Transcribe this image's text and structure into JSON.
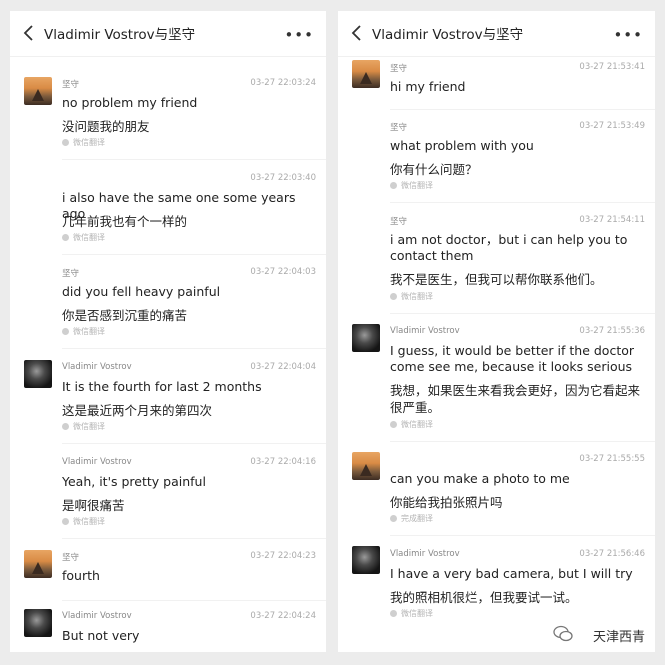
{
  "left": {
    "title": "Vladimir Vostrov与坚守",
    "messages": [
      {
        "sender": "坚守",
        "time": "03-27 22:03:24",
        "en": "no problem my friend",
        "zh": "没问题我的朋友",
        "tr": "微信翻译"
      },
      {
        "sender": "",
        "time": "03-27 22:03:40",
        "en": "i also have the same one some years ago",
        "zh": "几年前我也有个一样的",
        "tr": "微信翻译"
      },
      {
        "sender": "坚守",
        "time": "03-27 22:04:03",
        "en": "did you fell heavy painful",
        "zh": "你是否感到沉重的痛苦",
        "tr": "微信翻译"
      },
      {
        "sender": "Vladimir Vostrov",
        "time": "03-27 22:04:04",
        "en": "It is the fourth for last 2 months",
        "zh": "这是最近两个月来的第四次",
        "tr": "微信翻译"
      },
      {
        "sender": "Vladimir Vostrov",
        "time": "03-27 22:04:16",
        "en": "Yeah, it's pretty painful",
        "zh": "是啊很痛苦",
        "tr": "微信翻译"
      },
      {
        "sender": "坚守",
        "time": "03-27 22:04:23",
        "en": "fourth"
      },
      {
        "sender": "Vladimir Vostrov",
        "time": "03-27 22:04:24",
        "en": "But not very"
      }
    ]
  },
  "right": {
    "title": "Vladimir Vostrov与坚守",
    "messages": [
      {
        "sender": "坚守",
        "time": "03-27 21:53:41",
        "en": "hi my friend"
      },
      {
        "sender": "坚守",
        "time": "03-27 21:53:49",
        "en": "what problem with you",
        "zh": "你有什么问题？",
        "tr": "微信翻译"
      },
      {
        "sender": "坚守",
        "time": "03-27 21:54:11",
        "en": "i am not doctor，but i can help you to contact them",
        "zh": "我不是医生，但我可以帮你联系他们。",
        "tr": "微信翻译"
      },
      {
        "sender": "Vladimir Vostrov",
        "time": "03-27 21:55:36",
        "en": "I guess, it would be better if the doctor come see me, because it looks serious",
        "zh": "我想，如果医生来看我会更好，因为它看起来很严重。",
        "tr": "微信翻译"
      },
      {
        "sender": "",
        "time": "03-27 21:55:55",
        "en": "can you make a photo to me",
        "zh": "你能给我拍张照片吗",
        "tr": "完成翻译"
      },
      {
        "sender": "Vladimir Vostrov",
        "time": "03-27 21:56:46",
        "en": "I have a very bad camera, but I will try",
        "zh": "我的照相机很烂，但我要试一试。",
        "tr": "微信翻译"
      }
    ]
  },
  "watermark": "天津西青",
  "icons": {
    "back": "chevron-left-icon",
    "more": "more-dots-icon"
  }
}
